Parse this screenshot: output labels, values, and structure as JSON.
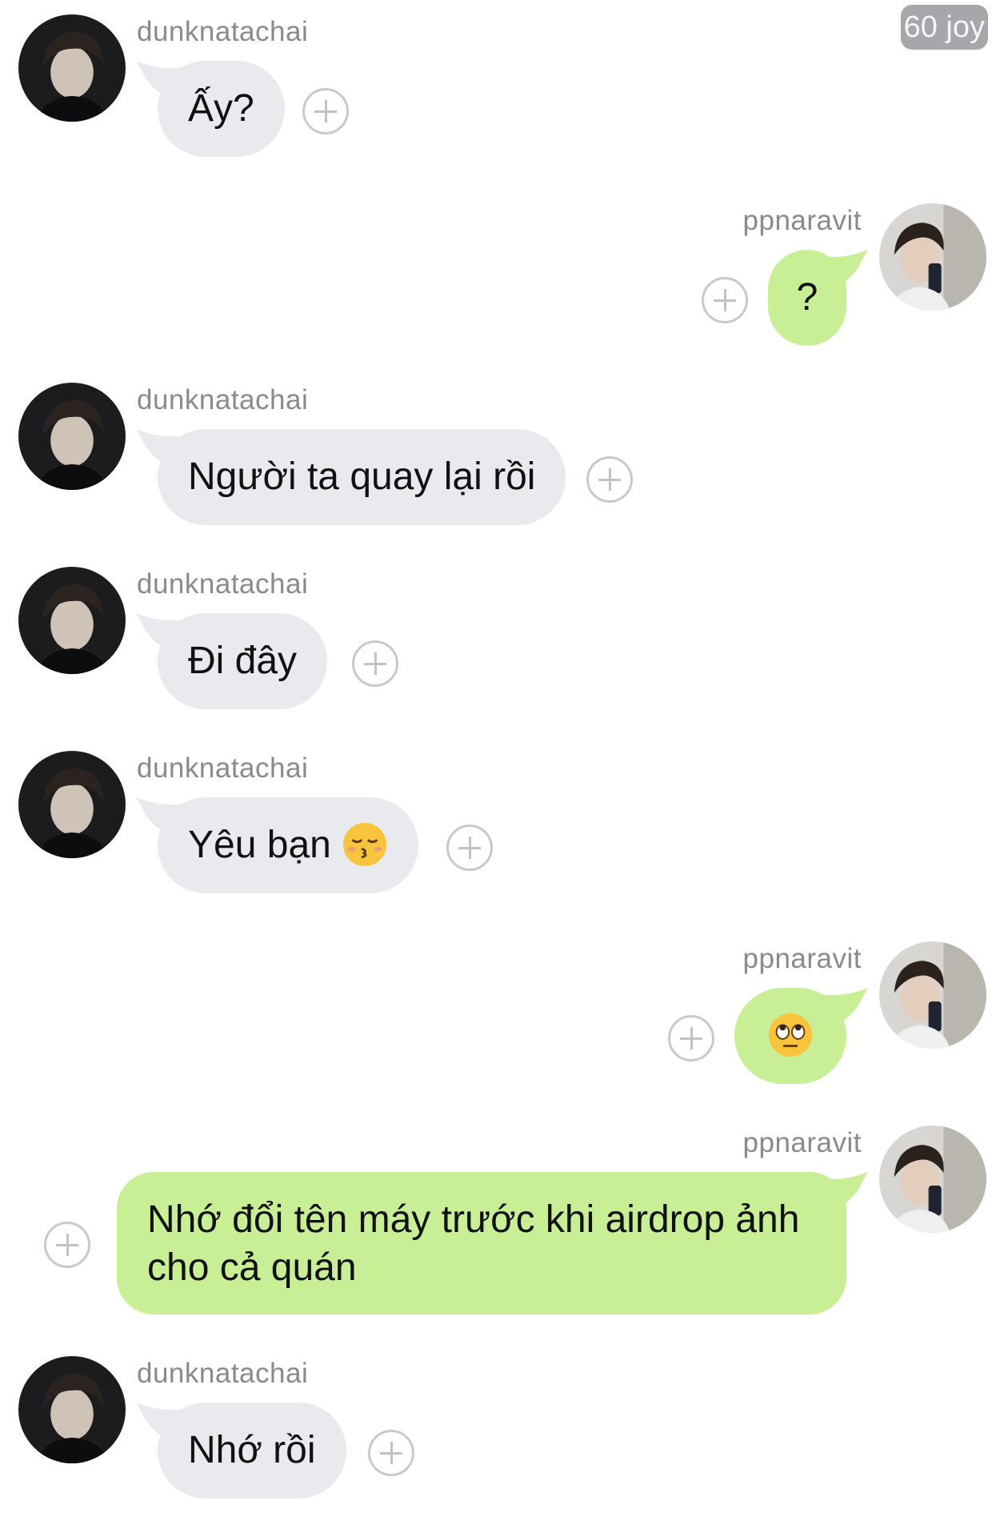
{
  "badge": {
    "text": "60 joy"
  },
  "users": {
    "left": "dunknatachai",
    "right": "ppnaravit"
  },
  "colors": {
    "incoming_bubble": "#e8eaed",
    "outgoing_bubble": "#c9ef96",
    "meta_text": "#8a8a8e"
  },
  "messages": [
    {
      "side": "in",
      "username": "dunknatachai",
      "text": "Ấy?"
    },
    {
      "side": "out",
      "username": "ppnaravit",
      "text": "?"
    },
    {
      "side": "in",
      "username": "dunknatachai",
      "text": "Người ta quay lại rồi"
    },
    {
      "side": "in",
      "username": "dunknatachai",
      "text": "Đi đây"
    },
    {
      "side": "in",
      "username": "dunknatachai",
      "text": "Yêu bạn",
      "emoji": "kissing-closed-eyes-emoji"
    },
    {
      "side": "out",
      "username": "ppnaravit",
      "text": "",
      "emoji": "rolling-eyes-emoji"
    },
    {
      "side": "out",
      "username": "ppnaravit",
      "text": "Nhớ đổi tên máy trước khi airdrop ảnh cho cả quán"
    },
    {
      "side": "in",
      "username": "dunknatachai",
      "text": "Nhớ rồi"
    }
  ]
}
